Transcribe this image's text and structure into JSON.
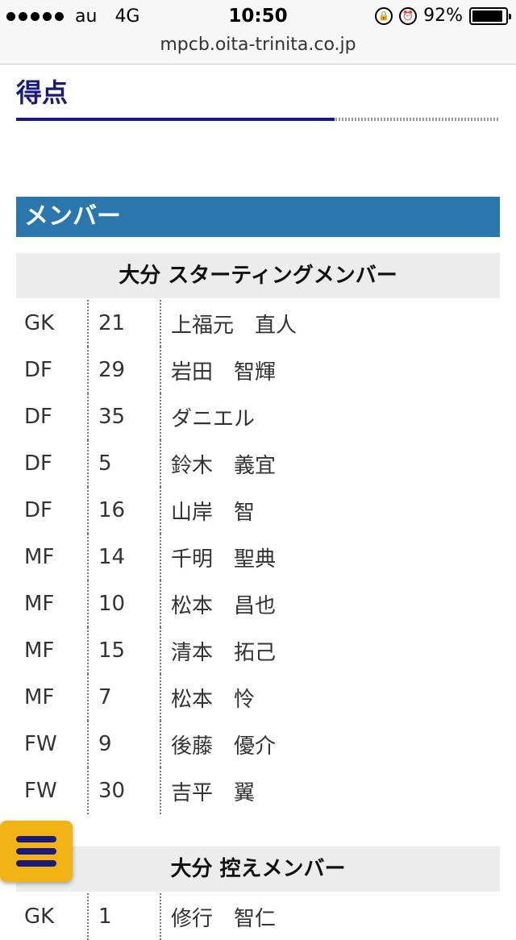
{
  "status_bar": {
    "carrier": "au",
    "network": "4G",
    "time": "10:50",
    "battery_percent": "92%",
    "battery_level": 0.92
  },
  "browser": {
    "url": "mpcb.oita-trinita.co.jp"
  },
  "score_section": {
    "title": "得点"
  },
  "member_section": {
    "title": "メンバー"
  },
  "starting": {
    "header": "大分 スターティングメンバー",
    "rows": [
      {
        "pos": "GK",
        "num": "21",
        "name": "上福元　直人"
      },
      {
        "pos": "DF",
        "num": "29",
        "name": "岩田　智輝"
      },
      {
        "pos": "DF",
        "num": "35",
        "name": "ダニエル"
      },
      {
        "pos": "DF",
        "num": "5",
        "name": "鈴木　義宜"
      },
      {
        "pos": "DF",
        "num": "16",
        "name": "山岸　智"
      },
      {
        "pos": "MF",
        "num": "14",
        "name": "千明　聖典"
      },
      {
        "pos": "MF",
        "num": "10",
        "name": "松本　昌也"
      },
      {
        "pos": "MF",
        "num": "15",
        "name": "清本　拓己"
      },
      {
        "pos": "MF",
        "num": "7",
        "name": "松本　怜"
      },
      {
        "pos": "FW",
        "num": "9",
        "name": "後藤　優介"
      },
      {
        "pos": "FW",
        "num": "30",
        "name": "吉平　翼"
      }
    ]
  },
  "substitutes": {
    "header": "大分 控えメンバー",
    "rows": [
      {
        "pos": "GK",
        "num": "1",
        "name": "修行　智仁"
      }
    ]
  },
  "colors": {
    "heading": "#1a1a7a",
    "banner": "#2a77ae",
    "menu_button": "#f2b415"
  }
}
